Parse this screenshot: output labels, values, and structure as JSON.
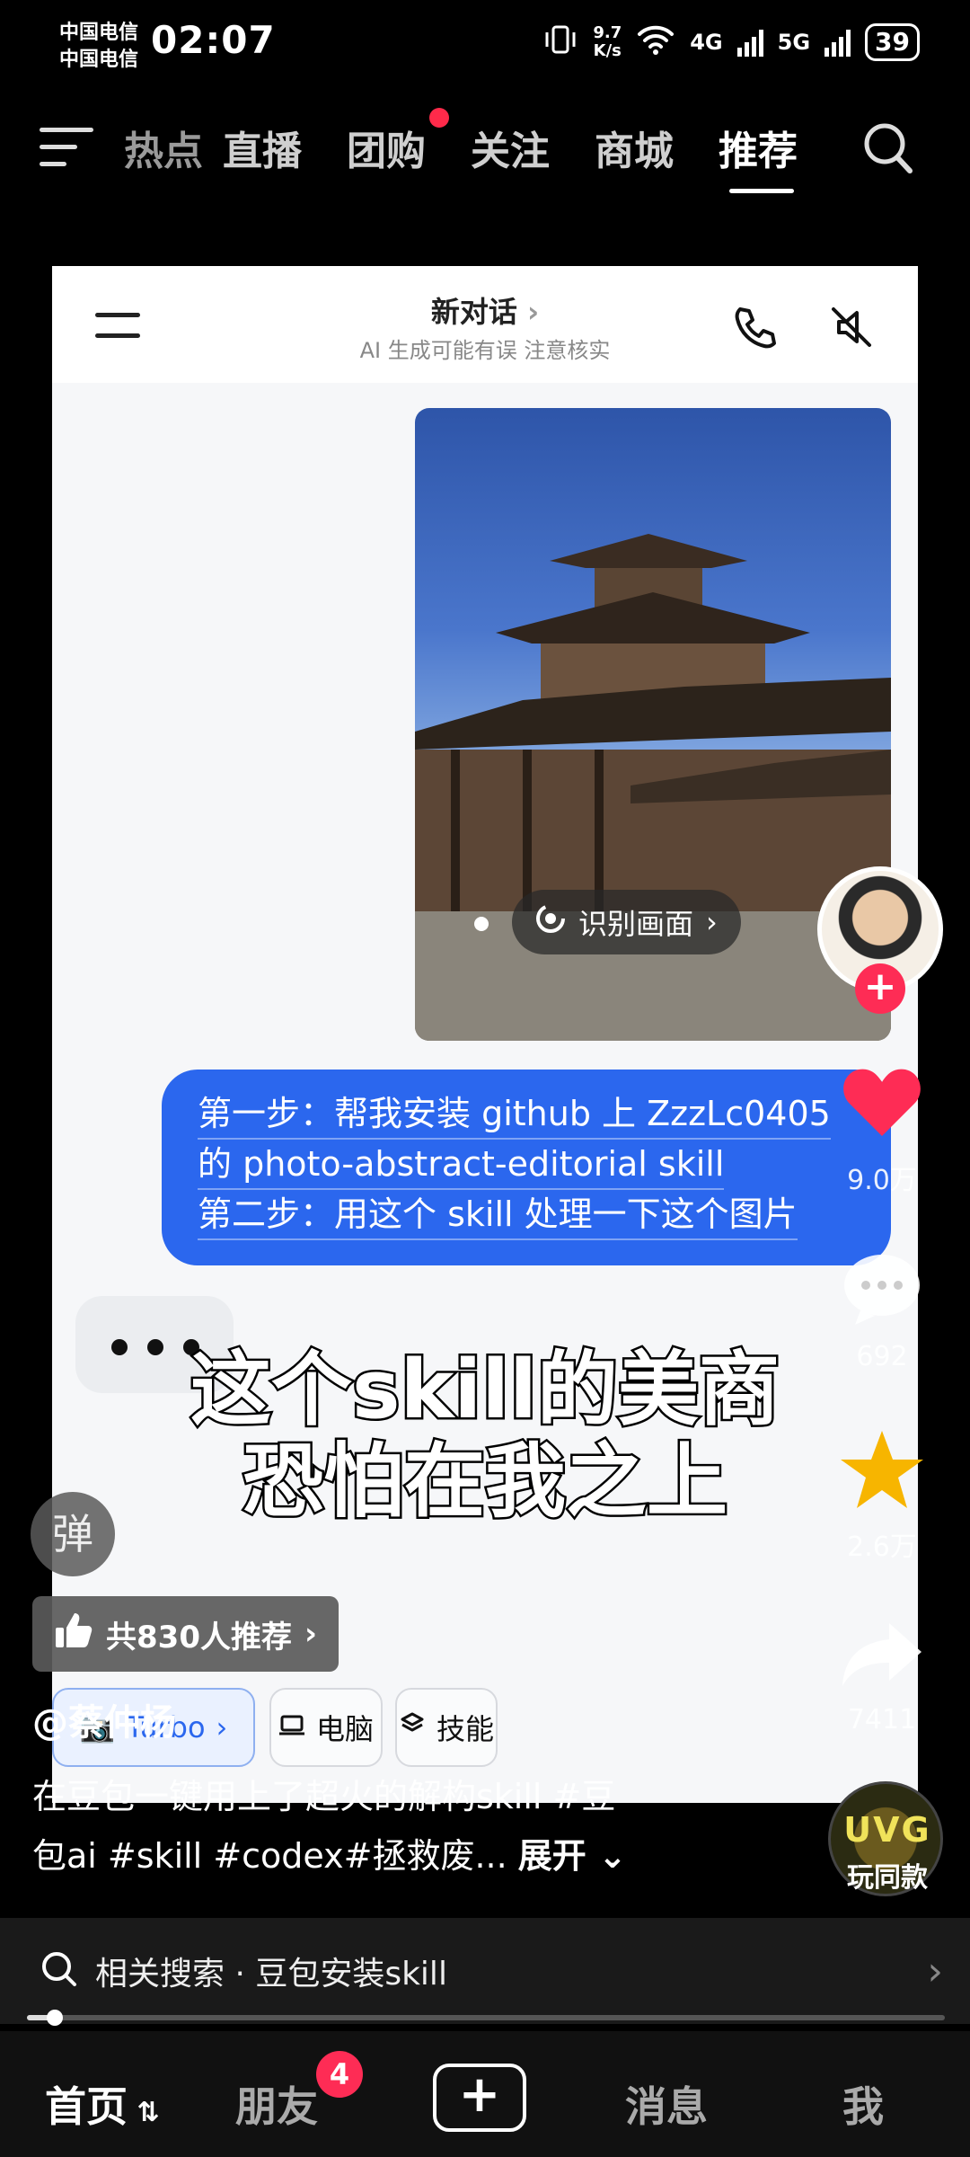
{
  "status_bar": {
    "carrier_1": "中国电信",
    "carrier_2": "中国电信",
    "time": "02:07",
    "net_speed_value": "9.7",
    "net_speed_unit": "K/s",
    "network_1": "4G",
    "network_2": "5G",
    "battery": "39"
  },
  "top_tabs": {
    "items": [
      "热点",
      "直播",
      "团购",
      "关注",
      "商城",
      "推荐"
    ],
    "active": "推荐"
  },
  "chat": {
    "title": "新对话",
    "subtitle": "AI 生成可能有误 注意核实",
    "identify_button": "识别画面",
    "message_lines": [
      "第一步：帮我安装 github 上 ZzzLc0405",
      "的 photo-abstract-editorial skill",
      "第二步：用这个 skill 处理一下这个图片"
    ],
    "modes": {
      "mode_1": "Turbo",
      "mode_1_prefix": "工作",
      "mode_2": "电脑",
      "mode_3": "技能"
    }
  },
  "overlay": {
    "line_1": "这个skill的美商",
    "line_2": "恐怕在我之上"
  },
  "side_rail": {
    "likes": "9.0万",
    "comments": "692",
    "favorites": "2.6万",
    "shares": "7411",
    "follow": "+"
  },
  "video_info": {
    "danmu_label": "弹",
    "recommend": "共830人推荐",
    "author": "@蔡仲杨",
    "caption_line_1": "在豆包一键用上了超火的解构skill #豆",
    "caption_line_2": "包ai #skill #codex#拯救废...",
    "expand": "展开",
    "music_label": "UVG",
    "music_sub": "玩同款"
  },
  "related_search": {
    "text": "相关搜索 · 豆包安装skill"
  },
  "playback": {
    "progress_fraction": 0.03
  },
  "bottom_nav": {
    "home": "首页",
    "friends": "朋友",
    "friends_badge": "4",
    "create": "+",
    "messages": "消息",
    "me": "我"
  },
  "colors": {
    "like_red": "#fe2c55",
    "bubble_blue": "#2b67ee",
    "favorite_gold": "#f7b500"
  }
}
